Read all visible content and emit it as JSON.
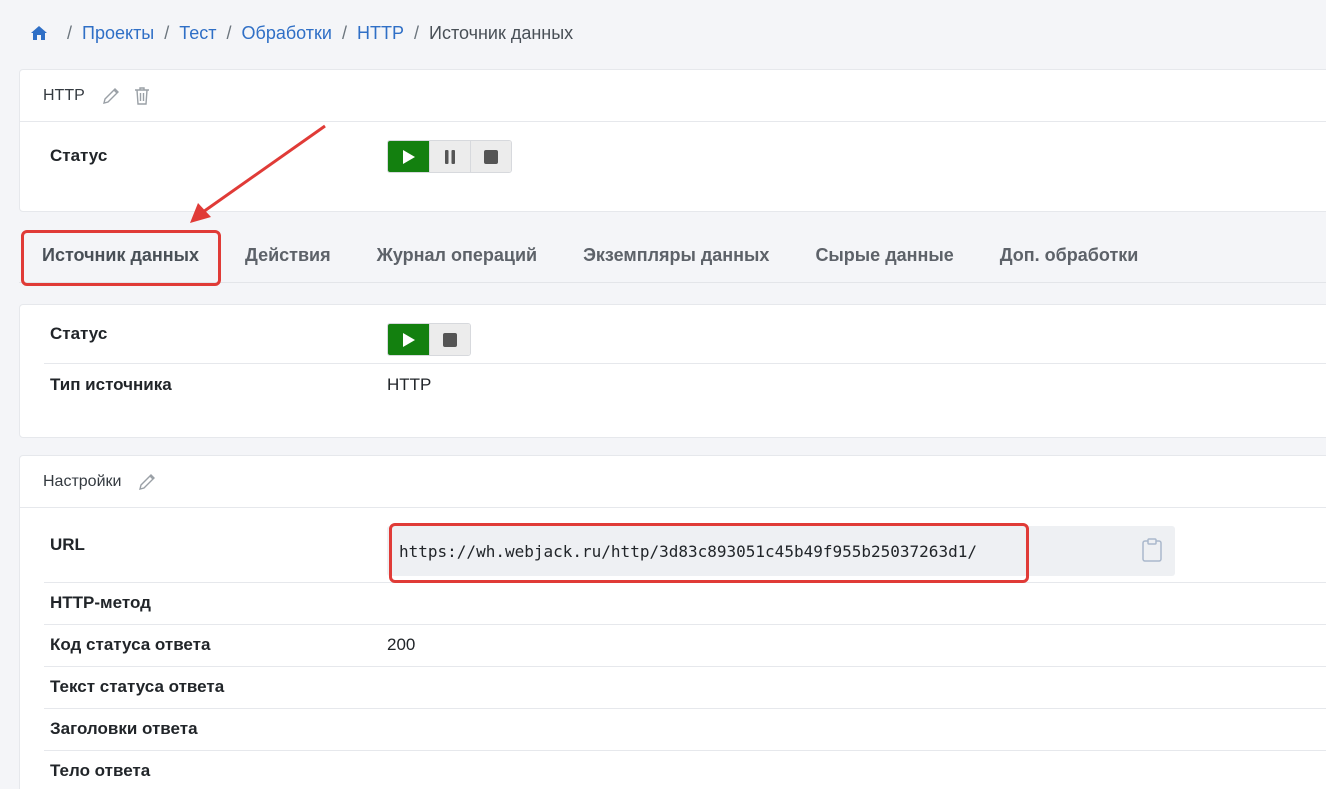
{
  "breadcrumb": {
    "items": [
      "Проекты",
      "Тест",
      "Обработки",
      "HTTP"
    ],
    "current": "Источник данных"
  },
  "process_card": {
    "title": "HTTP",
    "status_label": "Статус"
  },
  "tabs": [
    {
      "label": "Источник данных",
      "active": true
    },
    {
      "label": "Действия"
    },
    {
      "label": "Журнал операций"
    },
    {
      "label": "Экземпляры данных"
    },
    {
      "label": "Сырые данные"
    },
    {
      "label": "Доп. обработки"
    }
  ],
  "source_card": {
    "status_label": "Статус",
    "type_label": "Тип источника",
    "type_value": "HTTP"
  },
  "settings_card": {
    "title": "Настройки",
    "fields": [
      {
        "label": "URL",
        "value": "https://wh.webjack.ru/http/3d83c893051c45b49f955b25037263d1/"
      },
      {
        "label": "HTTP-метод",
        "value": ""
      },
      {
        "label": "Код статуса ответа",
        "value": "200"
      },
      {
        "label": "Текст статуса ответа",
        "value": ""
      },
      {
        "label": "Заголовки ответа",
        "value": ""
      },
      {
        "label": "Тело ответа",
        "value": ""
      }
    ]
  },
  "colors": {
    "link": "#2f6fc6",
    "play_button": "#13800f",
    "highlight": "#e03b37"
  },
  "icons": [
    "home-icon",
    "pencil-icon",
    "trash-icon",
    "play-icon",
    "pause-icon",
    "stop-icon",
    "clipboard-icon"
  ]
}
